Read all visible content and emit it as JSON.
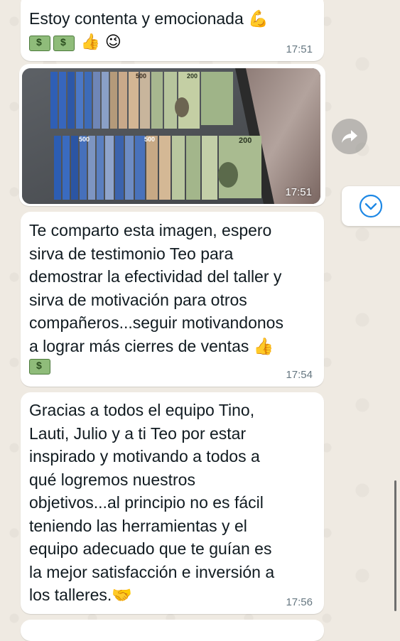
{
  "messages": [
    {
      "text": "Estoy contenta y emocionada 💪",
      "extra_emoji": "👍 😉",
      "time": "17:51"
    },
    {
      "type": "image",
      "time": "17:51"
    },
    {
      "text": "Te comparto esta imagen, espero\nsirva de testimonio  Teo para\ndemostrar la efectividad del taller y\nsirva de motivación para otros\ncompañeros...seguir motivandonos\na lograr más cierres de ventas 👍",
      "time": "17:54"
    },
    {
      "text": "Gracias a todos el equipo Tino,\nLauti, Julio y a ti Teo por estar\ninspirado y motivando a todos a\nqué logremos nuestros\nobjetivos...al principio no es fácil\nteniendo las herramientas y el\nequipo adecuado que te guían es\nla mejor satisfacción e inversión a\nlos talleres.🤝",
      "time": "17:56"
    }
  ],
  "controls": {
    "forward_icon": "forward-arrow-icon",
    "scroll_icon": "chevron-down-icon"
  },
  "colors": {
    "background": "#efeae2",
    "bubble": "#ffffff",
    "time": "#667781",
    "accent": "#1e88e5"
  }
}
